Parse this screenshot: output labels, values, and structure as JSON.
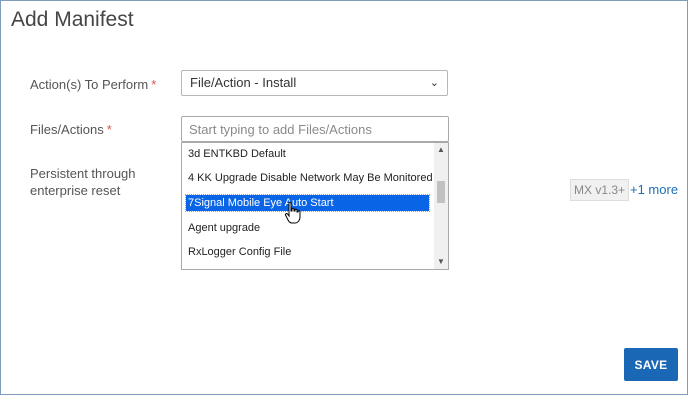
{
  "dialog": {
    "title": "Add Manifest"
  },
  "form": {
    "action_label": "Action(s) To Perform",
    "action_required": "*",
    "action_value": "File/Action - Install",
    "files_label": "Files/Actions",
    "files_required": "*",
    "files_placeholder": "Start typing to add Files/Actions",
    "persistent_label_line1": "Persistent through",
    "persistent_label_line2": "enterprise reset"
  },
  "dropdown": {
    "items": [
      {
        "label": "3d ENTKBD Default",
        "selected": false
      },
      {
        "label": "4 KK Upgrade Disable Network May Be Monitored",
        "selected": false
      },
      {
        "label": "7Signal Mobile Eye Auto Start",
        "selected": true
      },
      {
        "label": "Agent upgrade",
        "selected": false
      },
      {
        "label": "RxLogger Config File",
        "selected": false
      }
    ]
  },
  "compat": {
    "badge": "MX v1.3+",
    "more": "+1 more"
  },
  "footer": {
    "save_label": "SAVE"
  },
  "colors": {
    "primary": "#1a67b5",
    "selection": "#0a64e6",
    "required": "#d9534f",
    "link": "#1d6fb8"
  }
}
